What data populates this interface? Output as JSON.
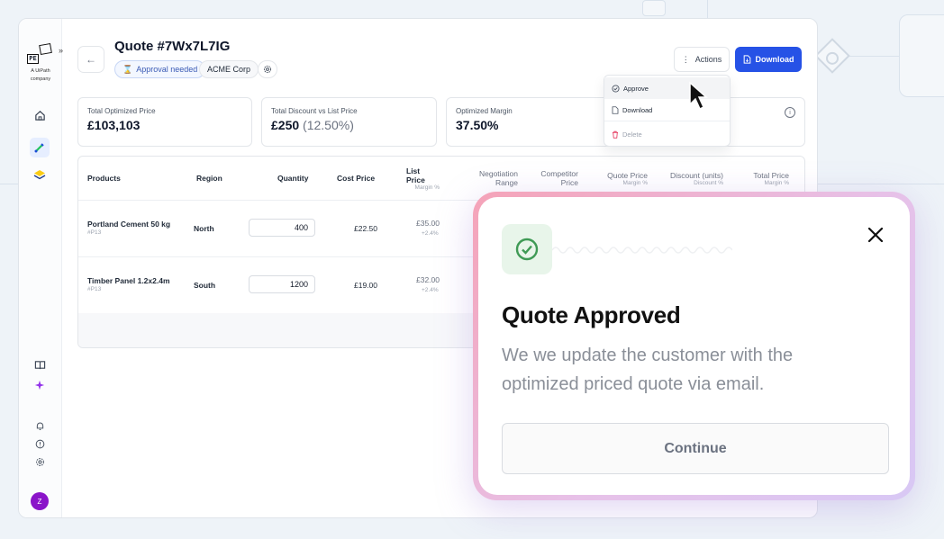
{
  "brand": {
    "logo_text": [
      "PE",
      "AK"
    ],
    "logo_subtitle_line1": "A UiPath",
    "logo_subtitle_line2": "company"
  },
  "header": {
    "quote_title": "Quote #7Wx7L7IG",
    "status_badge": "Approval needed",
    "customer_badge": "ACME Corp",
    "actions_label": "Actions",
    "download_label": "Download"
  },
  "stats": [
    {
      "label": "Total Optimized Price",
      "value": "£103,103",
      "secondary": ""
    },
    {
      "label": "Total Discount vs List Price",
      "value": "£250",
      "secondary": "(12.50%)"
    },
    {
      "label": "Optimized Margin",
      "value": "37.50%",
      "secondary": ""
    }
  ],
  "table": {
    "headers": {
      "products": "Products",
      "region": "Region",
      "quantity": "Quantity",
      "cost_price": "Cost Price",
      "list_price": "List Price",
      "list_price_sub": "Margin %",
      "negotiation_range_1": "Negotiation",
      "negotiation_range_2": "Range",
      "competitor_price_1": "Competitor",
      "competitor_price_2": "Price",
      "quote_price": "Quote Price",
      "quote_price_sub": "Margin %",
      "discount_units": "Discount (units)",
      "discount_sub": "Discount %",
      "total_price": "Total Price",
      "total_price_sub": "Margin %"
    },
    "rows": [
      {
        "product": "Portland Cement 50 kg",
        "sku": "#P13",
        "region": "North",
        "quantity": "400",
        "cost_price": "£22.50",
        "list_price": "£35.00",
        "list_margin": "+2.4%"
      },
      {
        "product": "Timber Panel 1.2x2.4m",
        "sku": "#P13",
        "region": "South",
        "quantity": "1200",
        "cost_price": "£19.00",
        "list_price": "£32.00",
        "list_margin": "+2.4%"
      }
    ]
  },
  "dropdown": {
    "items": [
      "Approve",
      "Download",
      "Delete"
    ]
  },
  "modal": {
    "title": "Quote Approved",
    "body": "We we update the customer with the optimized priced quote via email.",
    "button": "Continue"
  },
  "colors": {
    "accent": "#2652e6",
    "avatar": "#8a14c9",
    "success": "#3f9a55"
  },
  "avatar_initial": "Z"
}
